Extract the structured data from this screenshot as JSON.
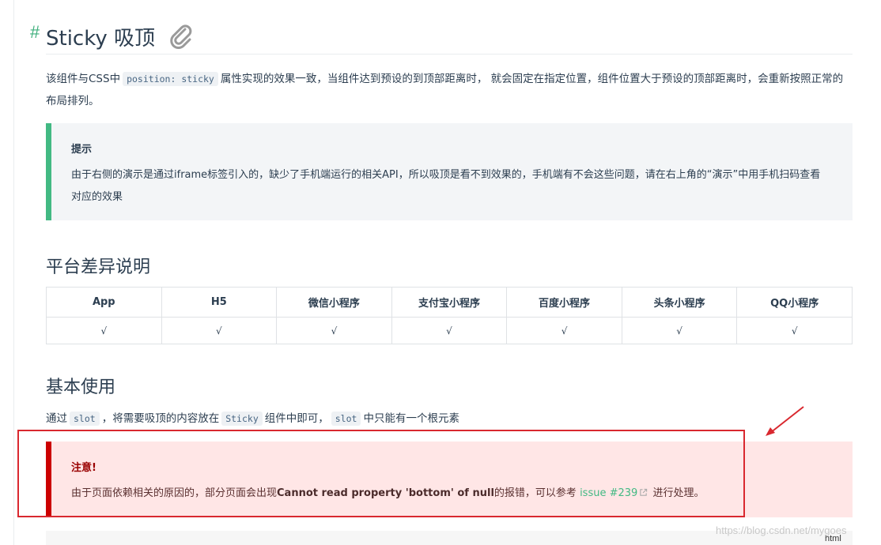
{
  "header": {
    "hash": "#",
    "title": "Sticky 吸顶"
  },
  "intro": {
    "before": "该组件与CSS中",
    "code": "position: sticky",
    "after": "属性实现的效果一致，当组件达到预设的到顶部距离时， 就会固定在指定位置，组件位置大于预设的顶部距离时，会重新按照正常的布局排列。"
  },
  "tip": {
    "title": "提示",
    "body": "由于右侧的演示是通过iframe标签引入的，缺少了手机端运行的相关API，所以吸顶是看不到效果的，手机端有不会这些问题，请在右上角的“演示”中用手机扫码查看对应的效果"
  },
  "platform_section": {
    "heading": "平台差异说明",
    "columns": [
      "App",
      "H5",
      "微信小程序",
      "支付宝小程序",
      "百度小程序",
      "头条小程序",
      "QQ小程序"
    ],
    "row": [
      "√",
      "√",
      "√",
      "√",
      "√",
      "√",
      "√"
    ]
  },
  "usage_section": {
    "heading": "基本使用",
    "text1": "通过",
    "code1": "slot",
    "text2": "，将需要吸顶的内容放在",
    "code2": "Sticky",
    "text3": "组件中即可，",
    "code3": "slot",
    "text4": "中只能有一个根元素"
  },
  "warning": {
    "title": "注意!",
    "before": "由于页面依赖相关的原因的，部分页面会出现",
    "bold": "Cannot read property 'bottom' of null",
    "middle": "的报错，可以参考",
    "link": "issue #239",
    "after": "进行处理。"
  },
  "code_block": {
    "lang": "html"
  },
  "watermark": "https://blog.csdn.net/mygoes",
  "colors": {
    "tip_border": "#42b983",
    "warn_border": "#cc0000",
    "warn_bg": "#ffe6e6",
    "annotation_red": "#d9282f",
    "link": "#42b983"
  }
}
